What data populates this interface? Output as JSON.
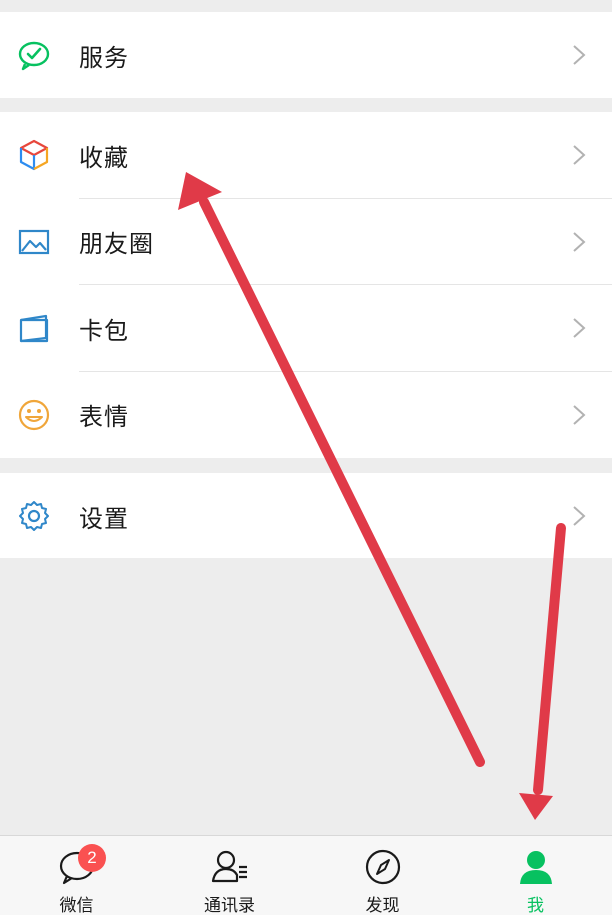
{
  "menu": {
    "services": {
      "label": "服务",
      "icon": "wechat-pay-icon"
    },
    "favorites": {
      "label": "收藏",
      "icon": "cube-icon"
    },
    "moments": {
      "label": "朋友圈",
      "icon": "photo-icon"
    },
    "cards": {
      "label": "卡包",
      "icon": "card-icon"
    },
    "stickers": {
      "label": "表情",
      "icon": "smiley-icon"
    },
    "settings": {
      "label": "设置",
      "icon": "gear-icon"
    }
  },
  "tabbar": {
    "tabs": [
      {
        "label": "微信",
        "icon": "chat-bubble-icon",
        "badge": "2"
      },
      {
        "label": "通讯录",
        "icon": "contacts-icon"
      },
      {
        "label": "发现",
        "icon": "compass-icon"
      },
      {
        "label": "我",
        "icon": "person-icon",
        "active": true
      }
    ]
  },
  "colors": {
    "accent": "#07c160",
    "badge": "#fa5151",
    "annotation": "#e03a48",
    "background": "#ededed"
  }
}
